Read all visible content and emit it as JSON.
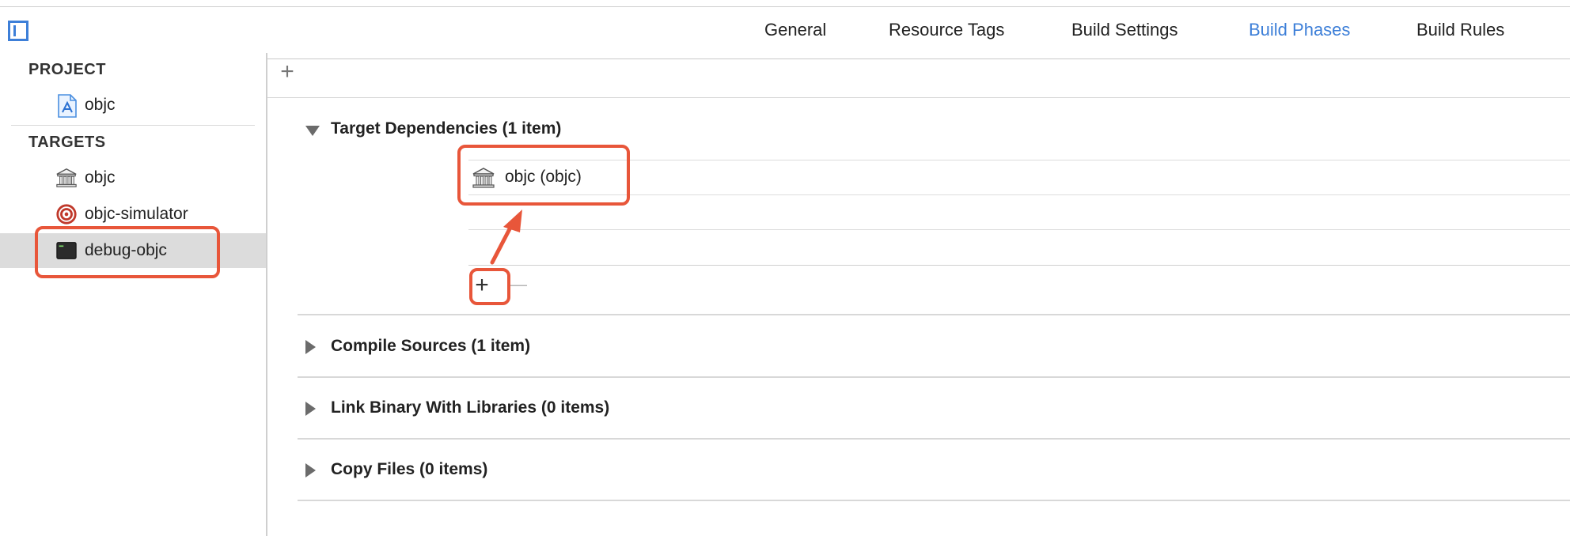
{
  "toolbar": {
    "sidebar_toggle_icon": "sidebar-toggle-icon",
    "tabs": [
      {
        "label": "General"
      },
      {
        "label": "Resource Tags"
      },
      {
        "label": "Build Settings"
      },
      {
        "label": "Build Phases",
        "active": true
      },
      {
        "label": "Build Rules"
      }
    ]
  },
  "sidebar": {
    "project_header": "PROJECT",
    "project_items": [
      {
        "label": "objc",
        "icon": "project-file-icon"
      }
    ],
    "targets_header": "TARGETS",
    "target_items": [
      {
        "label": "objc",
        "icon": "framework-icon"
      },
      {
        "label": "objc-simulator",
        "icon": "target-icon"
      },
      {
        "label": "debug-objc",
        "icon": "terminal-icon",
        "selected": true
      }
    ]
  },
  "main": {
    "add_symbol": "+",
    "phases": [
      {
        "title": "Target Dependencies (1 item)",
        "expanded": true,
        "items": [
          {
            "label": "objc (objc)",
            "icon": "framework-icon"
          }
        ],
        "add_symbol": "+",
        "remove_symbol": "—"
      },
      {
        "title": "Compile Sources (1 item)",
        "expanded": false
      },
      {
        "title": "Link Binary With Libraries (0 items)",
        "expanded": false
      },
      {
        "title": "Copy Files (0 items)",
        "expanded": false
      }
    ]
  },
  "colors": {
    "accent": "#3d7fd8",
    "highlight": "#e8563a",
    "selection": "#dcdcdc"
  }
}
